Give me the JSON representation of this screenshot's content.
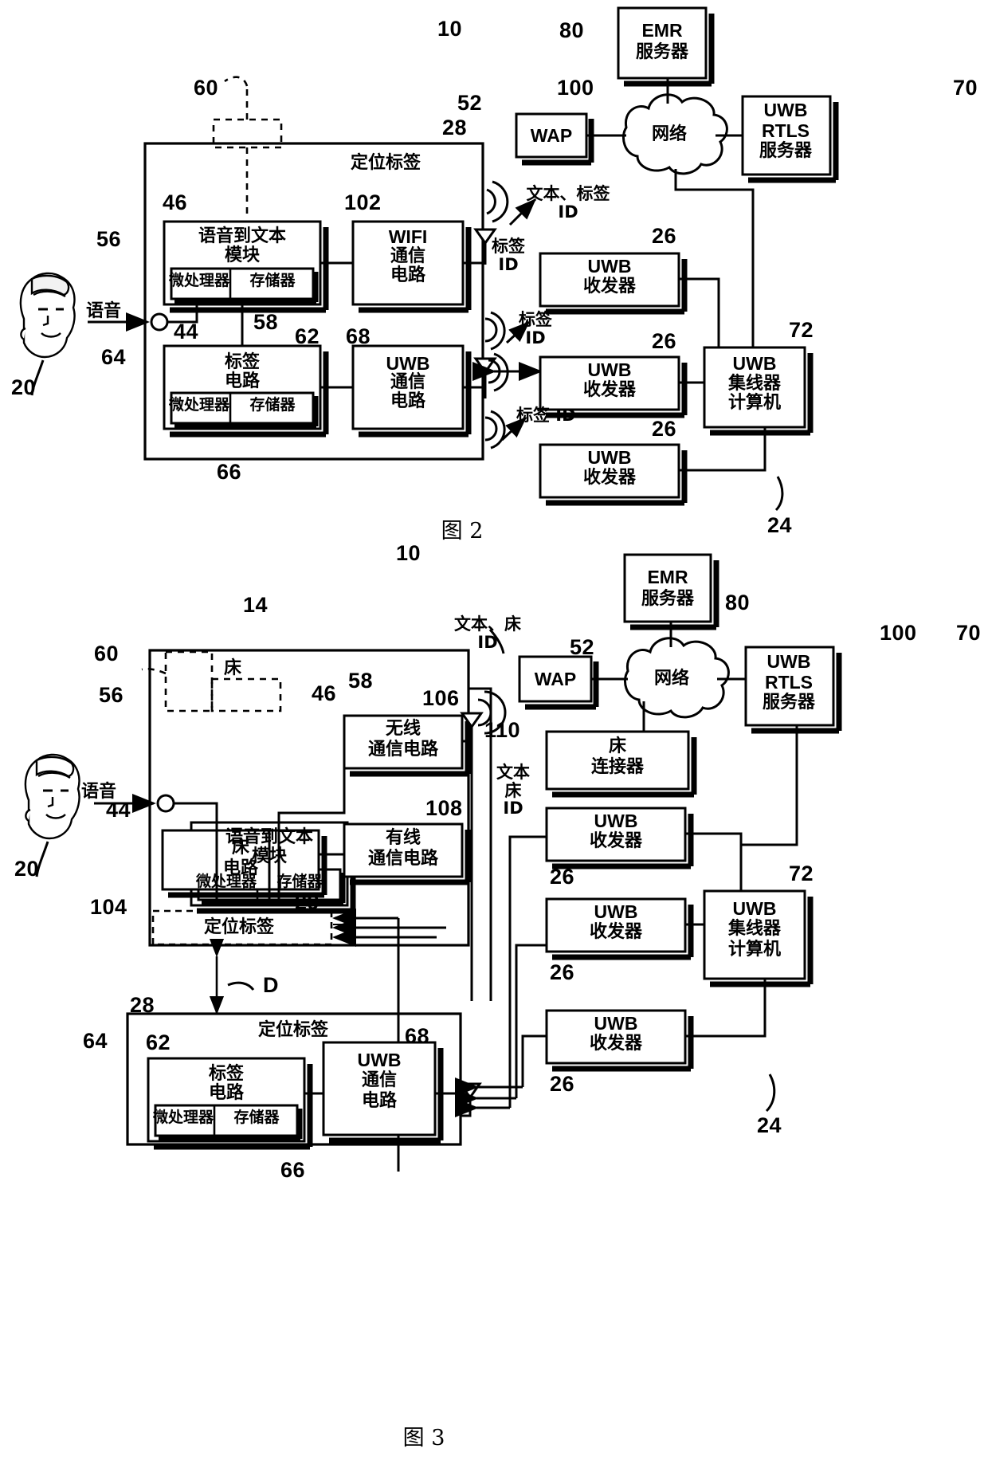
{
  "document": {
    "type": "patent-drawing",
    "language": "zh",
    "figures": [
      {
        "caption": "图 2",
        "ref": "10"
      },
      {
        "caption": "图 3",
        "ref": "10"
      }
    ]
  },
  "fig2": {
    "caption": "图 2",
    "system_ref": "10",
    "outer_tag": {
      "title": "定位标签",
      "ref": "28"
    },
    "dashed_top": {
      "ref": "60"
    },
    "blocks": [
      {
        "id": "speech",
        "ref": "46",
        "lines": [
          "语音到文本",
          "模块"
        ],
        "sub": [
          "微处理器",
          "存储器"
        ],
        "sub_ref": "56",
        "mem_ref": "58"
      },
      {
        "id": "wifi",
        "ref": "102",
        "lines": [
          "WIFI",
          "通信",
          "电路"
        ]
      },
      {
        "id": "tagcircuit",
        "ref": "62",
        "lines": [
          "标签",
          "电路"
        ],
        "sub": [
          "微处理器",
          "存储器"
        ],
        "sub_ref": "64",
        "mem_ref": "66"
      },
      {
        "id": "uwbcomm",
        "ref": "68",
        "lines": [
          "UWB",
          "通信",
          "电路"
        ]
      }
    ],
    "mic": {
      "ref": "44",
      "input_label": "语音"
    },
    "person": {
      "ref": "20"
    },
    "signals": [
      {
        "text": "文本、标签\nID"
      },
      {
        "text": "标签\nID"
      },
      {
        "text": "标签\nID"
      },
      {
        "text": "标签 ID"
      }
    ],
    "network_nodes": [
      {
        "id": "wap",
        "label": "WAP",
        "ref": "52"
      },
      {
        "id": "cloud",
        "label": "网络",
        "ref": "100"
      },
      {
        "id": "emr",
        "lines": [
          "EMR",
          "服务器"
        ],
        "ref": "80"
      },
      {
        "id": "rtls",
        "lines": [
          "UWB",
          "RTLS",
          "服务器"
        ],
        "ref": "70"
      }
    ],
    "transceivers": [
      {
        "lines": [
          "UWB",
          "收发器"
        ],
        "ref": "26"
      },
      {
        "lines": [
          "UWB",
          "收发器"
        ],
        "ref": "26"
      },
      {
        "lines": [
          "UWB",
          "收发器"
        ],
        "ref": "26"
      }
    ],
    "hub": {
      "lines": [
        "UWB",
        "集线器",
        "计算机"
      ],
      "ref": "72"
    },
    "rtls_group_ref": "24"
  },
  "fig3": {
    "caption": "图 3",
    "system_ref": "10",
    "bed": {
      "title": "床",
      "ref": "14"
    },
    "dashed_top": {
      "ref": "60"
    },
    "blocks": [
      {
        "id": "speech",
        "ref": "46",
        "lines": [
          "语音到文本",
          "模块"
        ],
        "sub": [
          "微处理器",
          "存储器"
        ],
        "sub_ref": "56",
        "mem_ref": "58"
      },
      {
        "id": "wireless",
        "ref": "106",
        "lines": [
          "无线",
          "通信电路"
        ]
      },
      {
        "id": "bedcircuit",
        "ref": "104",
        "lines": [
          "床",
          "电路"
        ]
      },
      {
        "id": "wired",
        "ref": "108",
        "lines": [
          "有线",
          "通信电路"
        ]
      },
      {
        "id": "bedtag",
        "ref": "29",
        "lines": [
          "定位标签"
        ]
      }
    ],
    "mic": {
      "ref": "44",
      "input_label": "语音"
    },
    "person": {
      "ref": "20"
    },
    "distance": {
      "label": "D"
    },
    "tag": {
      "ref": "28",
      "title": "定位标签",
      "blocks": [
        {
          "id": "tagcircuit",
          "ref": "62",
          "lines": [
            "标签",
            "电路"
          ],
          "sub": [
            "微处理器",
            "存储器"
          ],
          "sub_ref": "64",
          "mem_ref": "66"
        },
        {
          "id": "uwbcomm",
          "ref": "68",
          "lines": [
            "UWB",
            "通信",
            "电路"
          ]
        }
      ]
    },
    "signals": [
      {
        "text": "文本、床\nID"
      },
      {
        "text": "文本\n床\nID"
      }
    ],
    "network_nodes": [
      {
        "id": "wap",
        "label": "WAP",
        "ref": "52"
      },
      {
        "id": "cloud",
        "label": "网络",
        "ref": "100"
      },
      {
        "id": "emr",
        "lines": [
          "EMR",
          "服务器"
        ],
        "ref": "80"
      },
      {
        "id": "rtls",
        "lines": [
          "UWB",
          "RTLS",
          "服务器"
        ],
        "ref": "70"
      }
    ],
    "bed_connector": {
      "lines": [
        "床",
        "连接器"
      ],
      "ref": "110"
    },
    "transceivers": [
      {
        "lines": [
          "UWB",
          "收发器"
        ],
        "ref": "26"
      },
      {
        "lines": [
          "UWB",
          "收发器"
        ],
        "ref": "26"
      },
      {
        "lines": [
          "UWB",
          "收发器"
        ],
        "ref": "26"
      }
    ],
    "hub": {
      "lines": [
        "UWB",
        "集线器",
        "计算机"
      ],
      "ref": "72"
    },
    "rtls_group_ref": "24"
  },
  "colors": {
    "ink": "#000000",
    "paper": "#ffffff"
  }
}
